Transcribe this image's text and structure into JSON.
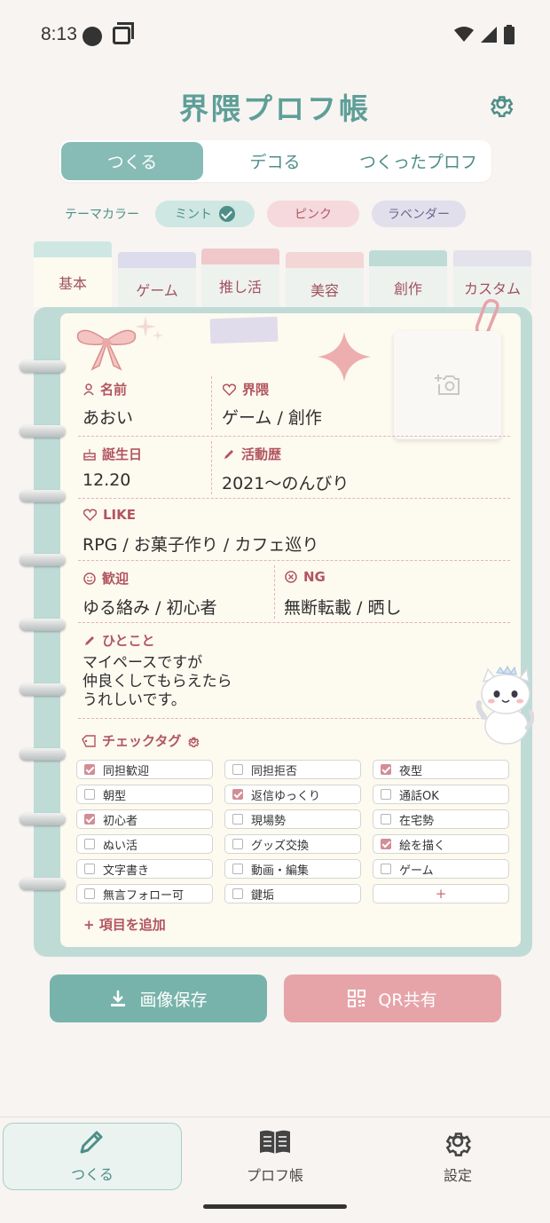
{
  "status_bar": {
    "time": "8:13"
  },
  "header": {
    "title": "界隈プロフ帳"
  },
  "segments": [
    "つくる",
    "デコる",
    "つくったプロフ"
  ],
  "theme": {
    "label": "テーマカラー",
    "options": [
      "ミント",
      "ピンク",
      "ラベンダー"
    ],
    "colors": {
      "mint": "#86bcb5",
      "pink": "#e6a4a8",
      "lavender": "#e2dfec"
    }
  },
  "tabs": [
    "基本",
    "ゲーム",
    "推し活",
    "美容",
    "創作",
    "カスタム"
  ],
  "profile": {
    "name_label": "名前",
    "name_value": "あおい",
    "genre_label": "界隈",
    "genre_value": "ゲーム / 創作",
    "birthday_label": "誕生日",
    "birthday_value": "12.20",
    "history_label": "活動歴",
    "history_value": "2021〜のんびり",
    "like_label": "LIKE",
    "like_value": "RPG / お菓子作り / カフェ巡り",
    "welcome_label": "歓迎",
    "welcome_value": "ゆる絡み / 初心者",
    "ng_label": "NG",
    "ng_value": "無断転載 / 晒し",
    "comment_label": "ひとこと",
    "comment_lines": [
      "マイペースですが",
      "仲良くしてもらえたら",
      "うれしいです。"
    ]
  },
  "check_tags": {
    "title": "チェックタグ",
    "items": [
      {
        "label": "同担歓迎",
        "checked": true
      },
      {
        "label": "同担拒否",
        "checked": false
      },
      {
        "label": "夜型",
        "checked": true
      },
      {
        "label": "朝型",
        "checked": false
      },
      {
        "label": "返信ゆっくり",
        "checked": true
      },
      {
        "label": "通話OK",
        "checked": false
      },
      {
        "label": "初心者",
        "checked": true
      },
      {
        "label": "現場勢",
        "checked": false
      },
      {
        "label": "在宅勢",
        "checked": false
      },
      {
        "label": "ぬい活",
        "checked": false
      },
      {
        "label": "グッズ交換",
        "checked": false
      },
      {
        "label": "絵を描く",
        "checked": true
      },
      {
        "label": "文字書き",
        "checked": false
      },
      {
        "label": "動画・編集",
        "checked": false
      },
      {
        "label": "ゲーム",
        "checked": false
      },
      {
        "label": "無言フォロー可",
        "checked": false
      },
      {
        "label": "鍵垢",
        "checked": false
      }
    ],
    "add_tag": "+",
    "add_item": "+ 項目を追加"
  },
  "actions": {
    "save": "画像保存",
    "qr": "QR共有"
  },
  "nav": {
    "create": "つくる",
    "book": "プロフ帳",
    "settings": "設定"
  }
}
